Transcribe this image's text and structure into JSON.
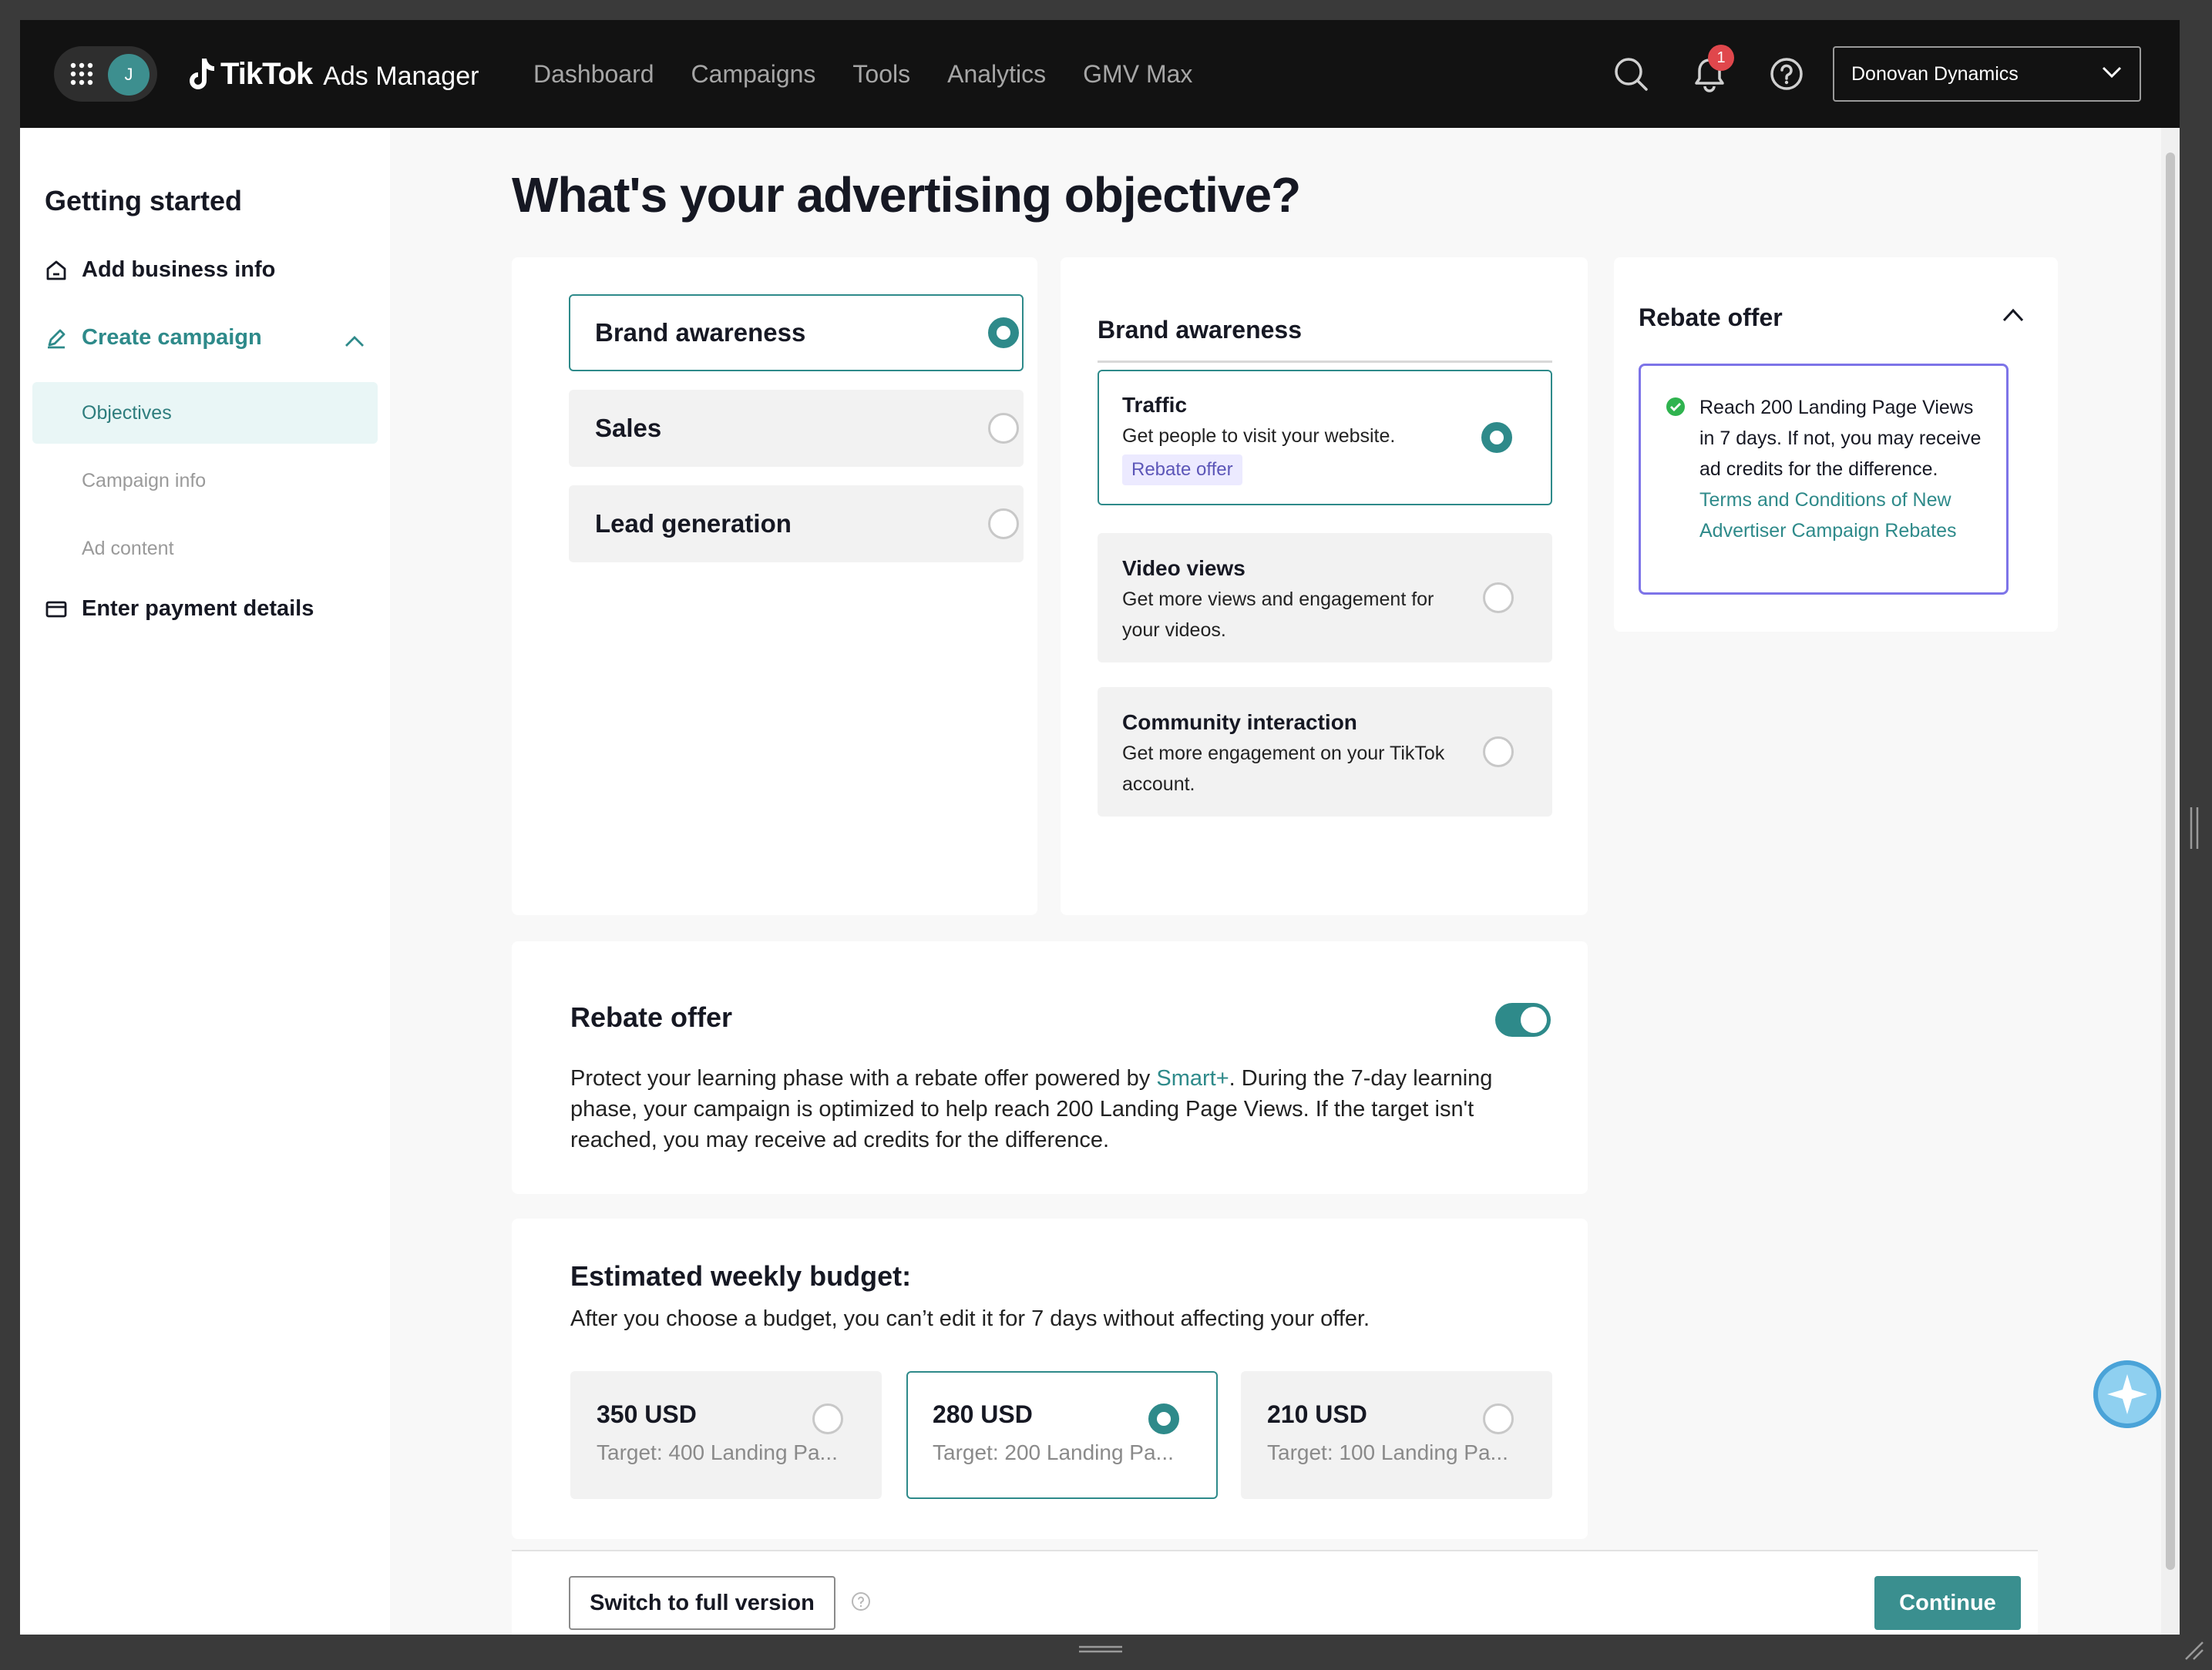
{
  "app": {
    "avatar_initial": "J",
    "brand": "TikTok",
    "product": "Ads Manager",
    "notification_count": "1",
    "account": "Donovan Dynamics",
    "accent_color": "#2e8a8a"
  },
  "nav": {
    "items": [
      "Dashboard",
      "Campaigns",
      "Tools",
      "Analytics",
      "GMV Max"
    ]
  },
  "sidebar": {
    "title": "Getting started",
    "add_business": "Add business info",
    "create_campaign": "Create campaign",
    "sub_items": [
      "Objectives",
      "Campaign info",
      "Ad content"
    ],
    "payment": "Enter payment details"
  },
  "page": {
    "title": "What's your advertising objective?"
  },
  "objectives": {
    "items": [
      "Brand awareness",
      "Sales",
      "Lead generation"
    ],
    "selected": "Brand awareness"
  },
  "goals": {
    "heading": "Brand awareness",
    "options": [
      {
        "title": "Traffic",
        "desc": "Get people to visit your website.",
        "tag": "Rebate offer",
        "selected": true
      },
      {
        "title": "Video views",
        "desc": "Get more views and engagement for your videos.",
        "selected": false
      },
      {
        "title": "Community interaction",
        "desc": "Get more engagement on your TikTok account.",
        "selected": false
      }
    ]
  },
  "rebate_side": {
    "title": "Rebate offer",
    "text": "Reach 200 Landing Page Views in 7 days. If not, you may receive ad credits for the difference.",
    "link": "Terms and Conditions of New Advertiser Campaign Rebates"
  },
  "rebate_section": {
    "title": "Rebate offer",
    "toggle_on": true,
    "text_before": "Protect your learning phase with a rebate offer powered by ",
    "link": "Smart+",
    "text_after": ". During the 7-day learning phase, your campaign is optimized to help reach 200 Landing Page Views. If the target isn't reached, you may receive ad credits for the difference."
  },
  "budget": {
    "title": "Estimated weekly budget:",
    "subtitle": "After you choose a budget, you can’t edit it for 7 days without affecting your offer.",
    "options": [
      {
        "amount": "350 USD",
        "target": "Target: 400 Landing Pa...",
        "selected": false
      },
      {
        "amount": "280 USD",
        "target": "Target: 200 Landing Pa...",
        "selected": true
      },
      {
        "amount": "210 USD",
        "target": "Target: 100 Landing Pa...",
        "selected": false
      }
    ]
  },
  "footer": {
    "switch_label": "Switch to full version",
    "continue_label": "Continue"
  }
}
